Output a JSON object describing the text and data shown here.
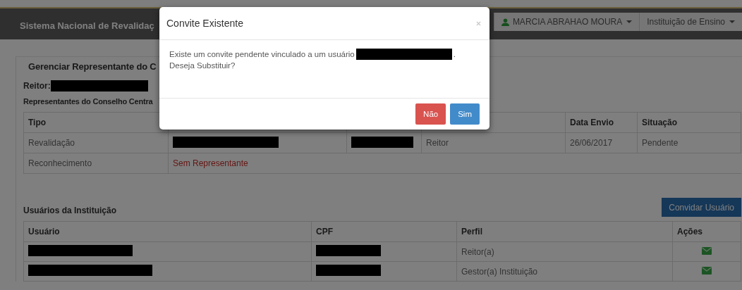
{
  "header": {
    "title": "Sistema Nacional de Revalidaç",
    "user_menu": "MARCIA ABRAHAO MOURA",
    "role_menu": "Instituição de Ensino"
  },
  "panel": {
    "title": "Gerenciar Representante do C",
    "reitor_label": "Reitor:",
    "section_title": "Representantes do Conselho Centra"
  },
  "representatives_table": {
    "columns": [
      {
        "label": "Tipo"
      },
      {},
      {},
      {},
      {
        "label": "Data Envio"
      },
      {
        "label": "Situação"
      }
    ],
    "rows": [
      [
        {
          "kind": "text",
          "text": "Revalidação"
        },
        {
          "kind": "redacted"
        },
        {
          "kind": "redacted"
        },
        {
          "kind": "text",
          "text": "Reitor"
        },
        {
          "kind": "text",
          "text": "26/06/2017"
        },
        {
          "kind": "text",
          "text": "Pendente"
        }
      ],
      [
        {
          "kind": "text",
          "text": "Reconhecimento"
        },
        {
          "kind": "warning",
          "text": "Sem Representante"
        },
        {
          "kind": "empty"
        },
        {
          "kind": "empty"
        },
        {
          "kind": "empty"
        },
        {
          "kind": "empty"
        }
      ]
    ]
  },
  "users_section": {
    "title": "Usuários da Instituição",
    "invite_button": "Convidar Usuário"
  },
  "users_table": {
    "columns": [
      "Usuário",
      "CPF",
      "Perfil",
      "Ações"
    ],
    "rows": [
      {
        "perfil": "Reitor(a)"
      },
      {
        "perfil": "Gestor(a) Instituição"
      }
    ]
  },
  "modal": {
    "title": "Convite Existente",
    "message_before": "Existe um convite pendente vinculado a um usuário",
    "message_after": ".",
    "message_line2": "Deseja Substituir?",
    "buttons": [
      {
        "label": "Não",
        "kind": "danger"
      },
      {
        "label": "Sim",
        "kind": "primary"
      }
    ]
  }
}
